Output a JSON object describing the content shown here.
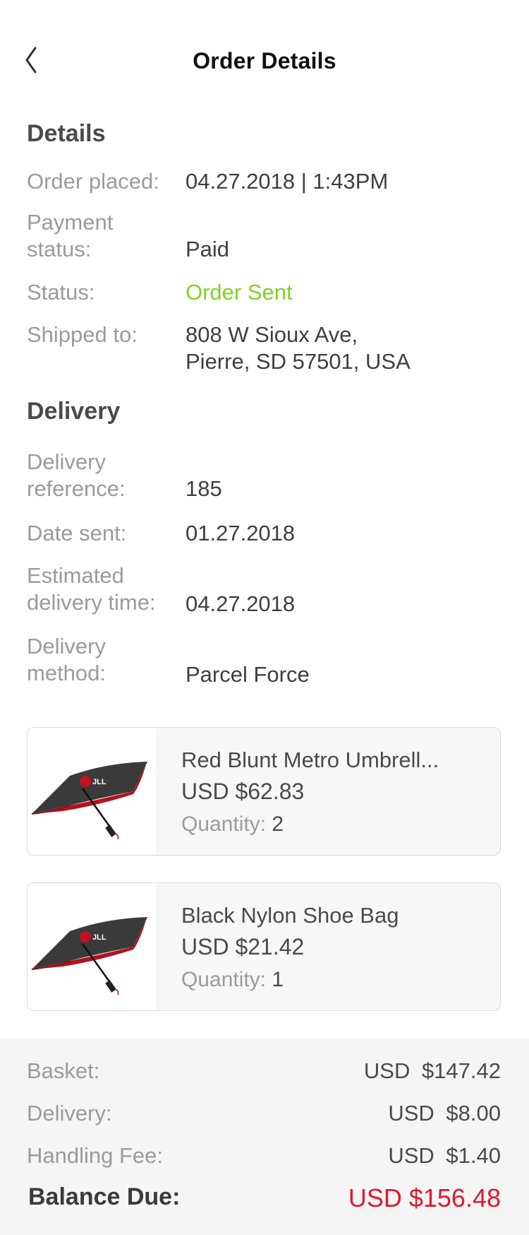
{
  "header": {
    "title": "Order Details",
    "back_icon": "chevron-left-icon"
  },
  "details": {
    "heading": "Details",
    "order_placed_label": "Order placed:",
    "order_placed_value": "04.27.2018 | 1:43PM",
    "payment_label_1": "Payment",
    "payment_label_2": "status:",
    "payment_value": "Paid",
    "status_label": "Status:",
    "status_value": "Order Sent",
    "status_color": "#7ed321",
    "shipped_label": "Shipped to:",
    "shipped_line1": "808 W Sioux Ave,",
    "shipped_line2": "Pierre, SD 57501, USA"
  },
  "delivery": {
    "heading": "Delivery",
    "reference_label_1": "Delivery",
    "reference_label_2": "reference:",
    "reference_value": "185",
    "date_sent_label": "Date sent:",
    "date_sent_value": "01.27.2018",
    "eta_label_1": "Estimated",
    "eta_label_2": "delivery time:",
    "eta_value": "04.27.2018",
    "method_label_1": "Delivery",
    "method_label_2": "method:",
    "method_value": "Parcel Force"
  },
  "items": [
    {
      "name": "Red Blunt Metro Umbrell...",
      "price_prefix": "USD $",
      "price": "62.83",
      "qty_label": "Quantity:",
      "qty": "2",
      "image_icon": "umbrella-image"
    },
    {
      "name": "Black Nylon Shoe Bag",
      "price_prefix": "USD $",
      "price": "21.42",
      "qty_label": "Quantity:",
      "qty": "1",
      "image_icon": "umbrella-image"
    }
  ],
  "summary": {
    "basket_label": "Basket:",
    "basket_value": "USD $147.42",
    "delivery_label": "Delivery:",
    "delivery_value": "USD $8.00",
    "handling_label": "Handling Fee:",
    "handling_value": "USD $1.40",
    "balance_label": "Balance Due:",
    "balance_value": "USD $156.48",
    "balance_color": "#e0182d"
  }
}
